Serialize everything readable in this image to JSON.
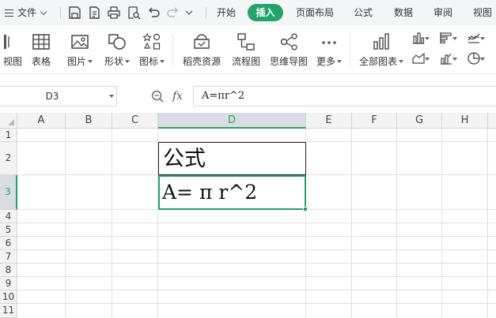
{
  "menubar": {
    "file_label": "文件",
    "tabs": [
      {
        "label": "开始",
        "active": false
      },
      {
        "label": "插入",
        "active": true
      },
      {
        "label": "页面布局",
        "active": false
      },
      {
        "label": "公式",
        "active": false
      },
      {
        "label": "数据",
        "active": false
      },
      {
        "label": "审阅",
        "active": false
      },
      {
        "label": "视图",
        "active": false
      }
    ]
  },
  "ribbon": {
    "view_label": "视图",
    "table_label": "表格",
    "picture_label": "图片",
    "shape_label": "形状",
    "icon_label": "图标",
    "daoke_label": "稻壳资源",
    "flowchart_label": "流程图",
    "mindmap_label": "思维导图",
    "more_label": "更多",
    "allcharts_label": "全部图表"
  },
  "formula_bar": {
    "name_box": "D3",
    "formula": "A=πr^2"
  },
  "sheet": {
    "columns": [
      "A",
      "B",
      "C",
      "D",
      "E",
      "F",
      "G",
      "H"
    ],
    "selected_column": "D",
    "rows": [
      "1",
      "2",
      "3",
      "4",
      "5",
      "6",
      "7",
      "8",
      "9",
      "10",
      "11"
    ],
    "selected_row": "3",
    "cells": {
      "D2": "公式",
      "D3": "A= π r^2"
    }
  },
  "colors": {
    "accent": "#23a36a",
    "menubar_bg": "#f4f5f7",
    "header_bg": "#f3f3f3",
    "gridline": "#e1e1e1"
  }
}
